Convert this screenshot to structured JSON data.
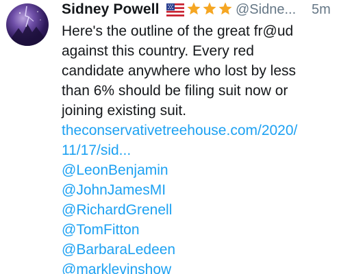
{
  "author": {
    "name": "Sidney Powell",
    "handle": "@Sidne...",
    "time": "5m",
    "badges": [
      "us-flag-icon",
      "star-icon",
      "star-icon",
      "star-icon"
    ]
  },
  "tweet": {
    "text_lines": [
      "Here's the outline of the great fr@ud",
      "against this country. Every red",
      "candidate anywhere who lost by less",
      "than 6% should be filing suit now or",
      "joining existing suit."
    ],
    "link_lines": [
      "theconservativetreehouse.com/2020/",
      "11/17/sid..."
    ],
    "mentions": [
      "@LeonBenjamin",
      "@JohnJamesMI",
      "@RichardGrenell",
      "@TomFitton",
      "@BarbaraLedeen",
      "@marklevinshow"
    ]
  },
  "colors": {
    "text": "#14171a",
    "secondary": "#657786",
    "link": "#1da1f2",
    "star": "#f5a623"
  }
}
